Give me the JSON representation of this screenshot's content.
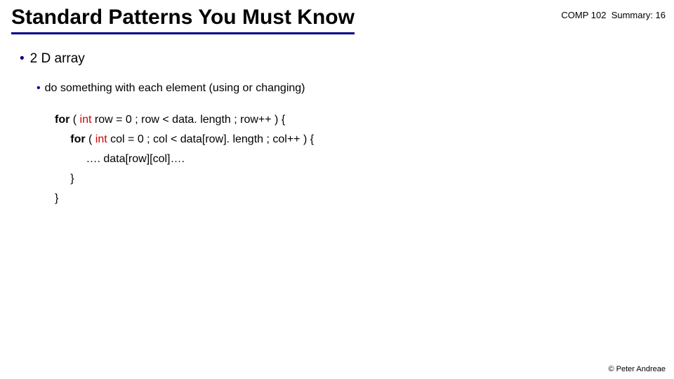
{
  "header": {
    "title": "Standard Patterns You Must Know",
    "course": "COMP 102  Summary: 16"
  },
  "content": {
    "bullet1": "2 D array",
    "bullet2": "do something with each element (using or changing)",
    "code": {
      "l1a": "for",
      "l1b": " ( ",
      "l1c": "int",
      "l1d": " row = 0 ; row < data. length ; row++ ) {",
      "l2a": "for",
      "l2b": " ( ",
      "l2c": "int",
      "l2d": " col = 0 ; col < data[row]. length ; col++ ) {",
      "l3": "…. data[row][col]….",
      "l4": "}",
      "l5": "}"
    }
  },
  "footer": "© Peter Andreae"
}
